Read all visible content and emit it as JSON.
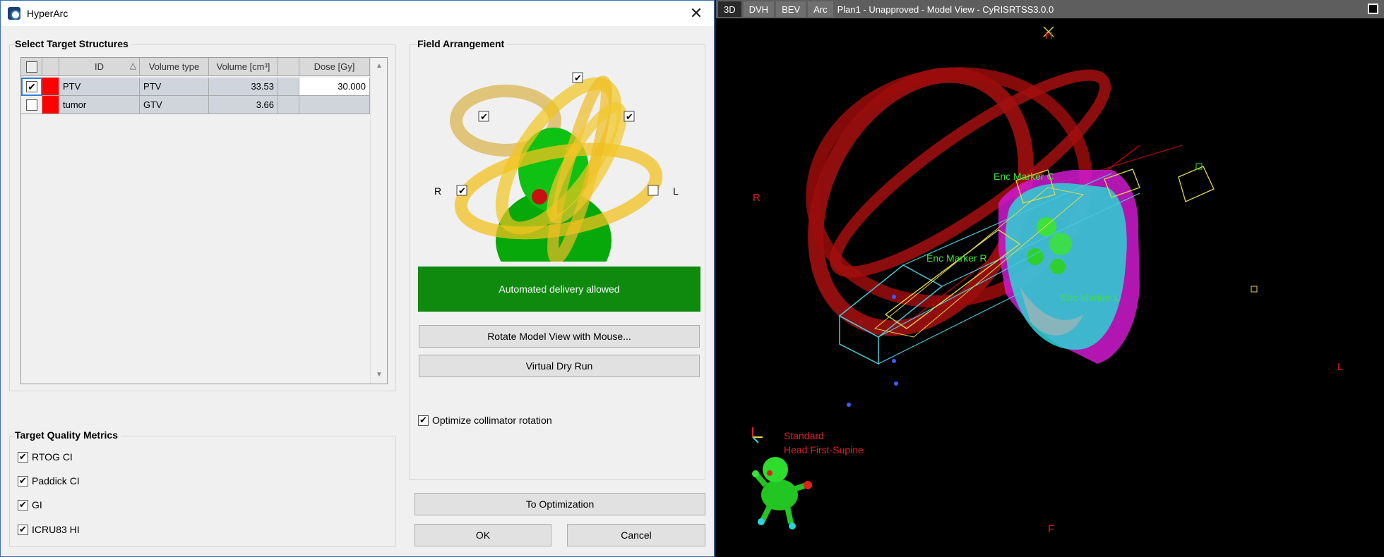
{
  "window": {
    "title": "HyperArc",
    "close_glyph": "✕"
  },
  "select_targets": {
    "title": "Select Target Structures",
    "columns": [
      "ID",
      "Volume type",
      "Volume [cm³]",
      "Dose [Gy]"
    ],
    "sort_glyph": "△",
    "rows": [
      {
        "checked": true,
        "id": "PTV",
        "volume_type": "PTV",
        "volume": "33.53",
        "dose": "30.000",
        "color": "#ff0000"
      },
      {
        "checked": false,
        "id": "tumor",
        "volume_type": "GTV",
        "volume": "3.66",
        "dose": "",
        "color": "#ff0000"
      }
    ]
  },
  "field_arrangement": {
    "title": "Field Arrangement",
    "left_label": "R",
    "right_label": "L",
    "status": "Automated delivery allowed",
    "rotate_button": "Rotate Model View with Mouse...",
    "dry_run_button": "Virtual Dry Run",
    "optimize_collimator": {
      "label": "Optimize collimator rotation",
      "checked": true
    }
  },
  "quality_metrics": {
    "title": "Target Quality Metrics",
    "items": [
      {
        "label": "RTOG CI",
        "checked": true
      },
      {
        "label": "Paddick CI",
        "checked": true
      },
      {
        "label": "GI",
        "checked": true
      },
      {
        "label": "ICRU83 HI",
        "checked": true
      }
    ]
  },
  "buttons": {
    "optimization": "To Optimization",
    "ok": "OK",
    "cancel": "Cancel"
  },
  "viewer": {
    "tabs": [
      "3D",
      "DVH",
      "BEV",
      "Arc"
    ],
    "active_tab": "3D",
    "title": "Plan1 - Unapproved - Model View - CyRISRTSS3.0.0",
    "orientation": {
      "head": "H",
      "foot": "F",
      "right": "R",
      "left": "L"
    },
    "markers": [
      "Enc Marker C",
      "Enc Marker R",
      "Enc Marker L"
    ],
    "patient_position": [
      "Standard",
      "Head First-Supine"
    ]
  },
  "colors": {
    "status_green": "#0f8a0f",
    "arc_red": "#a00f0f",
    "mask_magenta": "#d01ad0",
    "head_cyan": "#2ad4d4",
    "label_red": "#e02020",
    "marker_green": "#3de03d"
  }
}
